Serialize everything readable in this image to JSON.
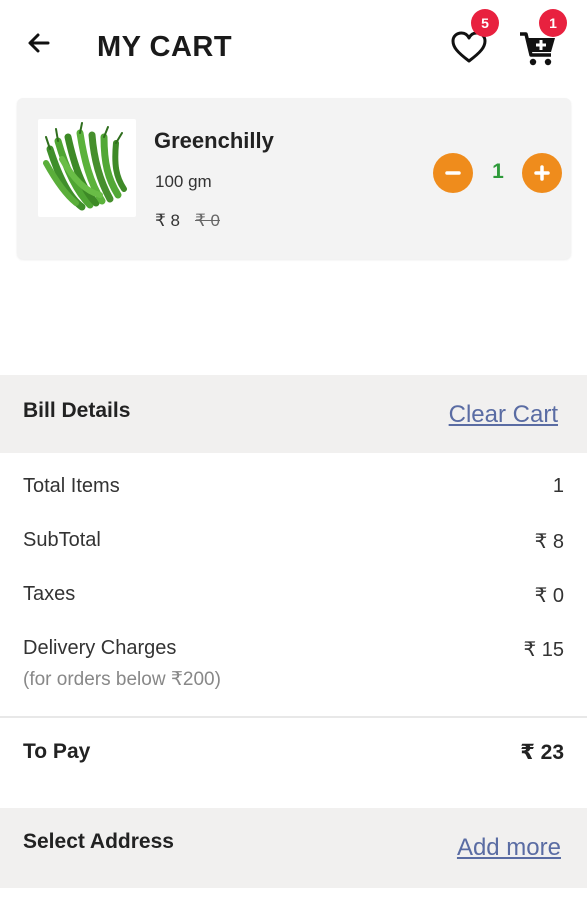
{
  "header": {
    "title": "MY CART",
    "back_icon": "arrow-left-icon",
    "wishlist_icon": "heart-icon",
    "wishlist_count": "5",
    "cart_icon": "cart-add-icon",
    "cart_count": "1"
  },
  "cart_item": {
    "name": "Greenchilly",
    "weight": "100 gm",
    "price": "₹ 8",
    "mrp": "₹ 0",
    "quantity": "1",
    "image": "green-chilli-image"
  },
  "bill": {
    "title": "Bill Details",
    "clear_label": "Clear Cart",
    "rows": [
      {
        "label": "Total Items",
        "value": "1"
      },
      {
        "label": "SubTotal",
        "value": "₹ 8"
      },
      {
        "label": "Taxes",
        "value": "₹ 0"
      },
      {
        "label": "Delivery Charges",
        "sub": "(for orders below ₹200)",
        "value": "₹ 15"
      }
    ],
    "to_pay_label": "To Pay",
    "to_pay_value": "₹ 23"
  },
  "address": {
    "title": "Select Address",
    "add_label": "Add more"
  },
  "colors": {
    "accent_orange": "#ef8c1c",
    "badge_red": "#e8213f",
    "link_blue": "#5a6ca3",
    "qty_green": "#2e9a3a"
  }
}
